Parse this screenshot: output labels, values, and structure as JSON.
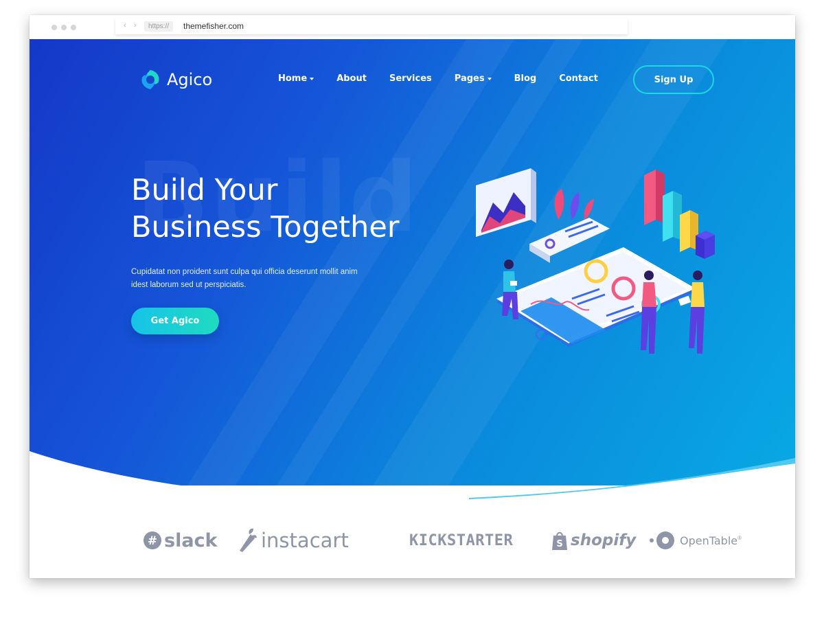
{
  "browser": {
    "protocol": "https://",
    "url": "themefisher.com"
  },
  "header": {
    "brand": "Agico",
    "nav": [
      {
        "label": "Home",
        "dropdown": true
      },
      {
        "label": "About",
        "dropdown": false
      },
      {
        "label": "Services",
        "dropdown": false
      },
      {
        "label": "Pages",
        "dropdown": true
      },
      {
        "label": "Blog",
        "dropdown": false
      },
      {
        "label": "Contact",
        "dropdown": false
      }
    ],
    "signup_label": "Sign Up"
  },
  "hero": {
    "bg_word": "Build",
    "title_line1": "Build Your",
    "title_line2": "Business Together",
    "subtitle": "Cupidatat non proident sunt culpa qui officia deserunt mollit anim idest laborum sed ut perspiciatis.",
    "cta_label": "Get Agico",
    "illustration_icon": "isometric-dashboard-illustration"
  },
  "brands": [
    {
      "name": "slack",
      "icon": "slack-logo-icon"
    },
    {
      "name": "instacart",
      "icon": "carrot-logo-icon"
    },
    {
      "name": "KICKSTARTER",
      "icon": ""
    },
    {
      "name": "shopify",
      "icon": "shopping-bag-logo-icon"
    },
    {
      "name": "OpenTable",
      "icon": "opentable-dot-logo-icon",
      "mark": "®"
    }
  ],
  "colors": {
    "hero_start": "#1438c8",
    "hero_end": "#08a9e3",
    "accent_teal": "#18d8e0",
    "brand_gray": "#8d95a6"
  }
}
